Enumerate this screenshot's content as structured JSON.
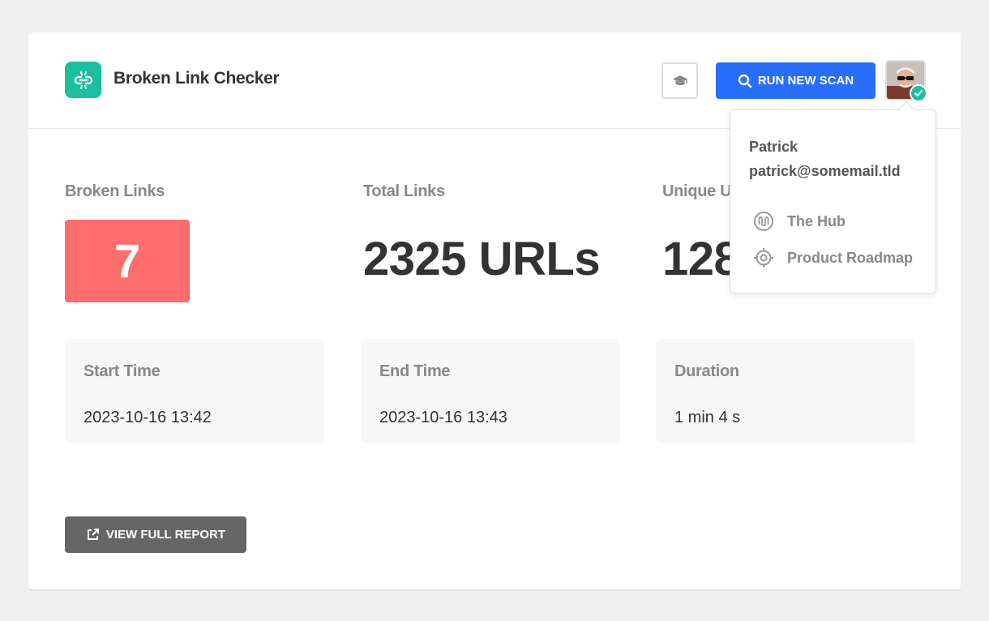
{
  "app": {
    "title": "Broken Link Checker",
    "accent": "#1bbf9f",
    "logo_icon": "broken-link-icon"
  },
  "header": {
    "tutorial_icon": "graduation-cap-icon",
    "scan_button": {
      "label": "RUN NEW SCAN",
      "icon": "search-icon",
      "color": "#286efa"
    },
    "avatar_status": "check-icon"
  },
  "stats": {
    "broken": {
      "label": "Broken Links",
      "value": "7",
      "color": "#ff6d6d"
    },
    "total": {
      "label": "Total Links",
      "value": "2325 URLs"
    },
    "unique": {
      "label": "Unique U",
      "value": "128"
    }
  },
  "times": {
    "start": {
      "label": "Start Time",
      "value": "2023-10-16 13:42"
    },
    "end": {
      "label": "End Time",
      "value": "2023-10-16 13:43"
    },
    "duration": {
      "label": "Duration",
      "value": "1 min 4 s"
    }
  },
  "report_button": {
    "label": "VIEW FULL REPORT",
    "icon": "external-link-icon"
  },
  "user_menu": {
    "name": "Patrick",
    "email": "patrick@somemail.tld",
    "items": [
      {
        "label": "The Hub",
        "icon": "hub-icon"
      },
      {
        "label": "Product Roadmap",
        "icon": "target-icon"
      }
    ]
  }
}
